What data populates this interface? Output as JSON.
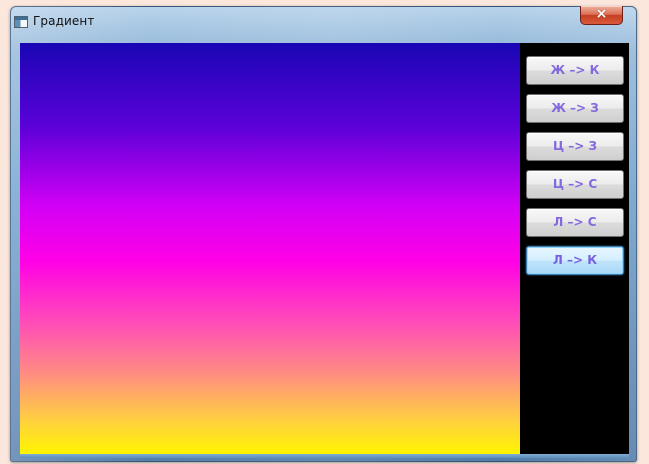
{
  "window": {
    "title": "Градиент"
  },
  "buttons": [
    {
      "label": "Ж –> К",
      "state": "normal"
    },
    {
      "label": "Ж –> З",
      "state": "normal"
    },
    {
      "label": "Ц –> З",
      "state": "normal"
    },
    {
      "label": "Ц –> С",
      "state": "normal"
    },
    {
      "label": "Л –> С",
      "state": "normal"
    },
    {
      "label": "Л –> К",
      "state": "active"
    }
  ],
  "colors": {
    "background": "#fbe7dc",
    "gradient_top": "#1906b4",
    "gradient_middle": "#ff00e6",
    "gradient_bottom": "#fff400",
    "button_text": "#8468de"
  }
}
